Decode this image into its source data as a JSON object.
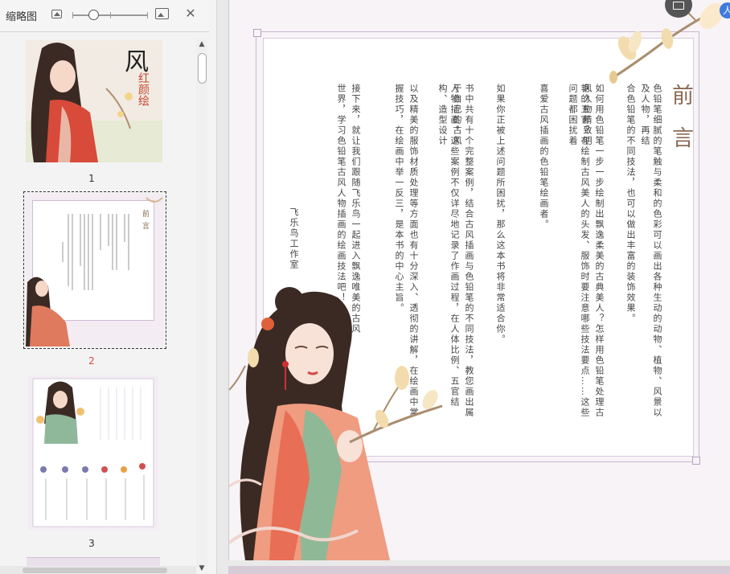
{
  "sidebar": {
    "title": "缩略图",
    "thumbnails": [
      {
        "label": "1",
        "title_char": "风",
        "subtitle": "红颜绘"
      },
      {
        "label": "2",
        "heading": "前言"
      },
      {
        "label": "3"
      }
    ]
  },
  "document": {
    "title": "前言",
    "columns": [
      "色铅笔细腻的笔触与柔和的色彩可以画出各种生动的动物、植物、风景以及人物，再结",
      "合色铅笔的不同技法，也可以做出丰富的装饰效果。",
      "如何用色铅笔一步一步绘制出飘逸柔美的古典美人？怎样用色铅笔处理古风人物精致明",
      "艳的五官？在绘制古风美人的头发、服饰时要注意哪些技法要点……这些问题都困扰着",
      "喜爱古风插画的色铅笔绘画者。",
      "如果你正被上述问题所困扰，那么这本书将非常适合你。",
      "书中共有十个完整案例，结合古风插画与色铅笔的不同技法，教您画出属于自己的古风",
      "人物插画。这些案例不仅详尽地记录了作画过程，在人体比例、五官结构、造型设计",
      "以及精美的服饰材质处理等方面也有十分深入、透彻的讲解，在绘画中掌",
      "握技巧，在绘画中举一反三，是本书的中心主旨。",
      "接下来，就让我们跟随飞乐鸟一起进入飘逸唯美的古风",
      "世界，学习色铅笔古风人物插画的绘画技法吧！"
    ],
    "signature": "飞乐鸟工作室"
  },
  "colors": {
    "sidebar_bg": "#f3f3f3",
    "page_bg": "#f7f3f7",
    "frame": "#c7b6cf",
    "title": "#8a6a55",
    "active_label": "#e2453c",
    "user_badge": "#3d7be0"
  },
  "icons": [
    "image-icon",
    "zoom-out-icon",
    "zoom-in-icon",
    "close-icon",
    "user-icon"
  ]
}
